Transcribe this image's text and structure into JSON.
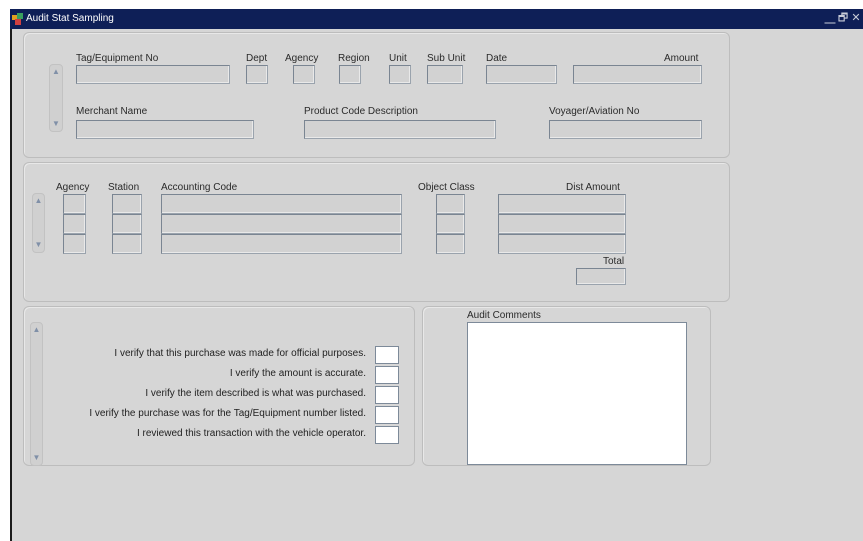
{
  "window": {
    "title": "Audit Stat Sampling",
    "controls": {
      "minimize": "⎽",
      "restore": "🗗",
      "close": "✕"
    }
  },
  "header": {
    "labels": {
      "tag": "Tag/Equipment No",
      "dept": "Dept",
      "agency": "Agency",
      "region": "Region",
      "unit": "Unit",
      "sub_unit": "Sub Unit",
      "date": "Date",
      "amount": "Amount",
      "merchant": "Merchant Name",
      "product": "Product Code Description",
      "voyager": "Voyager/Aviation No"
    },
    "values": {
      "tag": "",
      "dept": "",
      "agency": "",
      "region": "",
      "unit": "",
      "sub_unit": "",
      "date": "",
      "amount": "",
      "merchant": "",
      "product": "",
      "voyager": ""
    }
  },
  "accounting": {
    "columns": {
      "agency": "Agency",
      "station": "Station",
      "accounting_code": "Accounting Code",
      "object_class": "Object Class",
      "dist_amount": "Dist Amount"
    },
    "rows": [
      {
        "agency": "",
        "station": "",
        "accounting_code": "",
        "object_class": "",
        "dist_amount": ""
      },
      {
        "agency": "",
        "station": "",
        "accounting_code": "",
        "object_class": "",
        "dist_amount": ""
      },
      {
        "agency": "",
        "station": "",
        "accounting_code": "",
        "object_class": "",
        "dist_amount": ""
      }
    ],
    "total_label": "Total",
    "total_value": ""
  },
  "verification": {
    "items": [
      {
        "text": "I verify that this purchase was made for official purposes.",
        "checked": false
      },
      {
        "text": "I verify the amount is accurate.",
        "checked": false
      },
      {
        "text": "I verify the item described is what was purchased.",
        "checked": false
      },
      {
        "text": "I verify the purchase was for the Tag/Equipment number listed.",
        "checked": false
      },
      {
        "text": "I reviewed this transaction with the vehicle operator.",
        "checked": false
      }
    ]
  },
  "comments": {
    "label": "Audit Comments",
    "value": ""
  },
  "colors": {
    "titlebar": "#0e1f57",
    "window_bg": "#d6d6d6",
    "field_border": "#7a8592"
  }
}
